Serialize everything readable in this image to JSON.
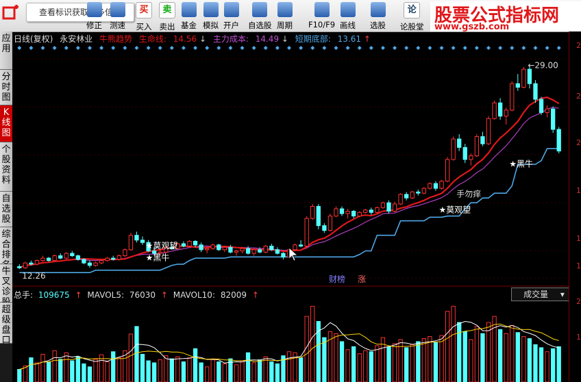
{
  "toolbar": {
    "tip": "查看标识获取更多信息",
    "buttons": [
      {
        "label": "修正",
        "icon": "edit-icon"
      },
      {
        "label": "测速",
        "icon": "speed-icon"
      },
      {
        "label": "买入",
        "icon": "buy-icon",
        "glyph": "买"
      },
      {
        "label": "卖出",
        "icon": "sell-icon",
        "glyph": "卖"
      },
      {
        "label": "基金",
        "icon": "fund-icon"
      },
      {
        "label": "模拟",
        "icon": "gavel-icon"
      },
      {
        "label": "开户",
        "icon": "lock-icon"
      },
      {
        "label": "自选股",
        "icon": "star-folder-icon"
      },
      {
        "label": "周期",
        "icon": "clock-icon"
      },
      {
        "label": "F10/F9",
        "icon": "f10-icon"
      },
      {
        "label": "画线",
        "icon": "pen-icon"
      },
      {
        "label": "选股",
        "icon": "grid-icon"
      },
      {
        "label": "论股堂",
        "icon": "forum-icon",
        "glyph": "论"
      }
    ]
  },
  "brand": {
    "title": "股票公式指标网",
    "url": "www.gszb.com"
  },
  "sidebar": {
    "tabs": [
      "应用",
      "分时图",
      "K线图",
      "个股资料",
      "自选股",
      "综合排名",
      "牛叉诊股",
      "超级盘口"
    ],
    "active": 2
  },
  "chart_info": {
    "period": "日线(复权)",
    "stock": "永安林业",
    "indicator": "牛熊趋势",
    "life_line_label": "生命线:",
    "life_line_value": "14.56",
    "cost_label": "主力成本:",
    "cost_value": "14.49",
    "bottom_label": "短期底部:",
    "bottom_value": "13.61"
  },
  "volume_info": {
    "total_label": "总手:",
    "total_value": "109675",
    "mavol5_label": "MAVOL5:",
    "mavol5_value": "76030",
    "mavol10_label": "MAVOL10:",
    "mavol10_value": "82009",
    "selector": "成交量"
  },
  "annotations": {
    "high_price": "29.00",
    "low_price": "12.26",
    "signals": [
      "莫观望",
      "黑牛",
      "莫观望",
      "黑牛",
      "手勿痒"
    ],
    "badges": [
      "财榜",
      "涨"
    ]
  },
  "colors": {
    "up": "#ff3333",
    "down": "#54ffff",
    "life_line": "#e0181b",
    "cost_line": "#b040c0",
    "bottom_line": "#4fa8e8",
    "mavol5": "#ffffff",
    "mavol10": "#ffd700",
    "diamond": "#4fa8e8"
  },
  "chart_data": {
    "type": "candlestick",
    "price_range": [
      11.0,
      30.0
    ],
    "candles": [
      [
        12.4,
        12.6,
        12.2,
        12.3
      ],
      [
        12.3,
        12.8,
        12.2,
        12.7
      ],
      [
        12.7,
        12.9,
        12.5,
        12.6
      ],
      [
        12.6,
        13.0,
        12.5,
        12.9
      ],
      [
        12.9,
        13.3,
        12.8,
        13.1
      ],
      [
        13.1,
        13.2,
        12.8,
        12.9
      ],
      [
        12.9,
        13.4,
        12.9,
        13.3
      ],
      [
        13.3,
        13.5,
        13.0,
        13.1
      ],
      [
        13.1,
        13.6,
        13.0,
        13.5
      ],
      [
        13.5,
        13.7,
        13.2,
        13.3
      ],
      [
        13.3,
        13.4,
        12.9,
        13.0
      ],
      [
        13.0,
        13.1,
        12.6,
        12.7
      ],
      [
        12.7,
        12.9,
        12.3,
        12.5
      ],
      [
        12.5,
        12.8,
        12.4,
        12.7
      ],
      [
        12.7,
        13.0,
        12.6,
        12.9
      ],
      [
        12.9,
        13.2,
        12.8,
        13.1
      ],
      [
        13.1,
        13.3,
        12.9,
        13.0
      ],
      [
        13.0,
        13.4,
        12.9,
        13.3
      ],
      [
        13.3,
        13.9,
        13.2,
        13.8
      ],
      [
        13.8,
        15.2,
        13.7,
        15.0
      ],
      [
        15.0,
        15.3,
        14.4,
        14.6
      ],
      [
        14.6,
        14.9,
        14.2,
        14.4
      ],
      [
        14.4,
        14.6,
        13.6,
        13.7
      ],
      [
        13.7,
        14.0,
        13.3,
        13.5
      ],
      [
        13.5,
        13.8,
        13.3,
        13.6
      ],
      [
        13.6,
        14.1,
        13.5,
        14.0
      ],
      [
        14.0,
        14.3,
        13.8,
        13.9
      ],
      [
        13.9,
        14.4,
        13.8,
        14.3
      ],
      [
        14.3,
        14.5,
        14.0,
        14.1
      ],
      [
        14.1,
        14.6,
        14.0,
        14.5
      ],
      [
        14.5,
        14.6,
        14.0,
        14.2
      ],
      [
        14.2,
        14.4,
        13.6,
        13.8
      ],
      [
        13.8,
        14.0,
        13.5,
        13.9
      ],
      [
        13.9,
        14.3,
        13.8,
        14.2
      ],
      [
        14.2,
        14.3,
        13.7,
        13.8
      ],
      [
        13.8,
        14.1,
        13.6,
        14.0
      ],
      [
        14.0,
        14.2,
        13.5,
        13.6
      ],
      [
        13.6,
        13.8,
        13.3,
        13.7
      ],
      [
        13.7,
        14.0,
        13.5,
        13.9
      ],
      [
        13.9,
        14.1,
        13.4,
        13.5
      ],
      [
        13.5,
        13.9,
        13.3,
        13.8
      ],
      [
        13.8,
        14.0,
        13.5,
        13.6
      ],
      [
        13.6,
        14.2,
        13.5,
        14.1
      ],
      [
        14.1,
        14.3,
        13.7,
        13.8
      ],
      [
        13.8,
        14.0,
        13.4,
        13.5
      ],
      [
        13.5,
        13.6,
        13.0,
        13.2
      ],
      [
        13.2,
        13.9,
        13.1,
        13.8
      ],
      [
        13.8,
        14.3,
        13.7,
        14.2
      ],
      [
        14.2,
        14.6,
        14.0,
        14.1
      ],
      [
        14.1,
        16.6,
        14.0,
        16.4
      ],
      [
        16.4,
        17.6,
        16.3,
        17.4
      ],
      [
        17.4,
        17.6,
        15.5,
        15.8
      ],
      [
        15.8,
        16.0,
        15.2,
        15.4
      ],
      [
        15.4,
        16.8,
        15.3,
        16.6
      ],
      [
        16.6,
        17.4,
        16.5,
        17.2
      ],
      [
        17.2,
        17.4,
        16.6,
        16.8
      ],
      [
        16.8,
        17.2,
        16.4,
        17.0
      ],
      [
        17.0,
        17.1,
        16.4,
        16.6
      ],
      [
        16.6,
        17.0,
        16.5,
        16.9
      ],
      [
        16.9,
        17.2,
        16.8,
        17.1
      ],
      [
        17.1,
        17.3,
        16.7,
        16.9
      ],
      [
        16.9,
        17.4,
        16.8,
        17.3
      ],
      [
        17.3,
        17.8,
        17.2,
        17.7
      ],
      [
        17.7,
        17.9,
        16.8,
        17.0
      ],
      [
        17.0,
        17.8,
        16.9,
        17.6
      ],
      [
        17.6,
        18.5,
        17.5,
        18.4
      ],
      [
        18.4,
        18.6,
        17.9,
        18.1
      ],
      [
        18.1,
        18.7,
        18.0,
        18.6
      ],
      [
        18.6,
        18.8,
        18.3,
        18.5
      ],
      [
        18.5,
        19.0,
        18.4,
        18.9
      ],
      [
        18.9,
        19.4,
        18.8,
        19.3
      ],
      [
        19.3,
        19.5,
        18.7,
        18.9
      ],
      [
        18.9,
        19.6,
        18.8,
        19.5
      ],
      [
        19.5,
        21.5,
        19.4,
        21.3
      ],
      [
        21.3,
        23.2,
        21.2,
        23.0
      ],
      [
        23.0,
        23.4,
        22.0,
        22.3
      ],
      [
        22.3,
        22.6,
        21.0,
        21.3
      ],
      [
        21.3,
        21.8,
        20.8,
        21.6
      ],
      [
        21.6,
        23.4,
        21.5,
        23.2
      ],
      [
        23.2,
        23.6,
        22.4,
        22.6
      ],
      [
        22.6,
        24.9,
        22.5,
        24.7
      ],
      [
        24.7,
        26.2,
        24.6,
        26.0
      ],
      [
        26.0,
        26.4,
        24.6,
        24.9
      ],
      [
        24.9,
        25.6,
        24.2,
        25.4
      ],
      [
        25.4,
        27.8,
        25.3,
        27.6
      ],
      [
        27.6,
        28.4,
        27.0,
        27.3
      ],
      [
        27.3,
        29.0,
        27.2,
        28.8
      ],
      [
        28.8,
        29.0,
        27.2,
        27.6
      ],
      [
        27.6,
        27.9,
        26.0,
        26.3
      ],
      [
        26.3,
        26.5,
        25.0,
        25.2
      ],
      [
        25.2,
        25.8,
        24.8,
        25.5
      ],
      [
        25.5,
        25.7,
        23.5,
        23.8
      ],
      [
        23.8,
        24.0,
        21.8,
        22.0
      ]
    ],
    "volume": [
      25,
      32,
      48,
      38,
      55,
      40,
      62,
      45,
      58,
      42,
      50,
      36,
      30,
      45,
      54,
      40,
      60,
      48,
      62,
      95,
      110,
      55,
      42,
      38,
      44,
      52,
      46,
      50,
      40,
      48,
      66,
      38,
      30,
      44,
      40,
      36,
      46,
      34,
      42,
      58,
      38,
      44,
      50,
      40,
      36,
      52,
      60,
      58,
      48,
      130,
      150,
      120,
      88,
      100,
      96,
      80,
      64,
      70,
      56,
      62,
      60,
      72,
      88,
      70,
      76,
      84,
      68,
      74,
      80,
      86,
      90,
      78,
      92,
      140,
      150,
      118,
      100,
      84,
      110,
      96,
      118,
      130,
      104,
      96,
      112,
      98,
      90,
      86,
      74,
      68,
      60,
      66,
      70
    ],
    "vol_ymax": 160
  }
}
